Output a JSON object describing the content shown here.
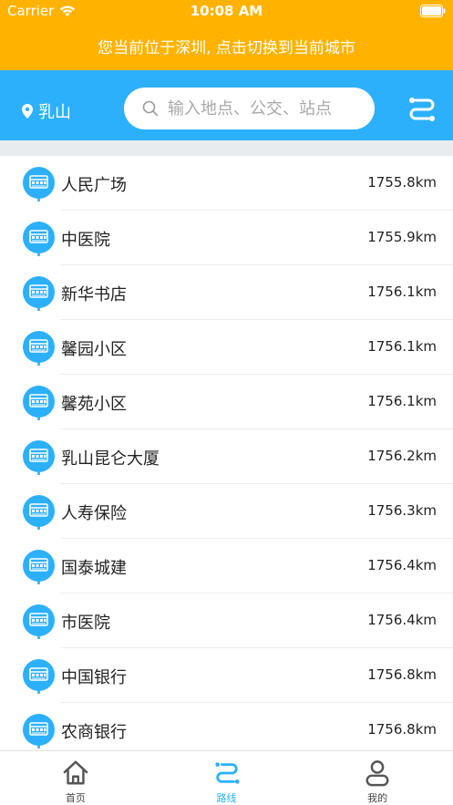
{
  "status_bar": {
    "carrier": "Carrier",
    "time": "10:08 AM"
  },
  "location_banner": {
    "text": "您当前位于深圳, 点击切换到当前城市"
  },
  "header": {
    "city": "乳山",
    "search_placeholder": "输入地点、公交、站点"
  },
  "stops": [
    {
      "name": "人民广场",
      "distance": "1755.8km"
    },
    {
      "name": "中医院",
      "distance": "1755.9km"
    },
    {
      "name": "新华书店",
      "distance": "1756.1km"
    },
    {
      "name": "馨园小区",
      "distance": "1756.1km"
    },
    {
      "name": "馨苑小区",
      "distance": "1756.1km"
    },
    {
      "name": "乳山昆仑大厦",
      "distance": "1756.2km"
    },
    {
      "name": "人寿保险",
      "distance": "1756.3km"
    },
    {
      "name": "国泰城建",
      "distance": "1756.4km"
    },
    {
      "name": "市医院",
      "distance": "1756.4km"
    },
    {
      "name": "中国银行",
      "distance": "1756.8km"
    },
    {
      "name": "农商银行",
      "distance": "1756.8km"
    }
  ],
  "tabbar": {
    "tabs": [
      {
        "label": "首页",
        "icon": "home-icon"
      },
      {
        "label": "路线",
        "icon": "route-icon"
      },
      {
        "label": "我的",
        "icon": "profile-icon"
      }
    ],
    "active_index": 1
  },
  "colors": {
    "banner_bg": "#FFB300",
    "header_bg": "#2DB0FB",
    "accent": "#2DB0FB",
    "divider_strip": "#E9ECEF"
  }
}
